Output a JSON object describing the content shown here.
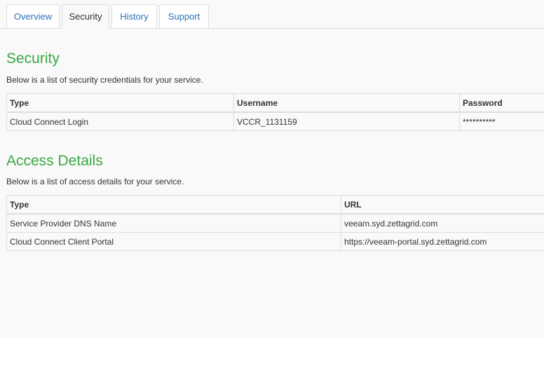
{
  "tabs": [
    {
      "label": "Overview",
      "active": false
    },
    {
      "label": "Security",
      "active": true
    },
    {
      "label": "History",
      "active": false
    },
    {
      "label": "Support",
      "active": false
    }
  ],
  "security": {
    "title": "Security",
    "description": "Below is a list of security credentials for your service.",
    "headers": [
      "Type",
      "Username",
      "Password"
    ],
    "rows": [
      [
        "Cloud Connect Login",
        "VCCR_1131159",
        "**********"
      ]
    ]
  },
  "access": {
    "title": "Access Details",
    "description": "Below is a list of access details for your service.",
    "headers": [
      "Type",
      "URL"
    ],
    "rows": [
      [
        "Service Provider DNS Name",
        "veeam.syd.zettagrid.com"
      ],
      [
        "Cloud Connect Client Portal",
        "https://veeam-portal.syd.zettagrid.com"
      ]
    ]
  },
  "colors": {
    "heading": "#3aa845",
    "link": "#2a6fb8",
    "panel_bg": "#f9f9f9",
    "border": "#dddddd"
  }
}
